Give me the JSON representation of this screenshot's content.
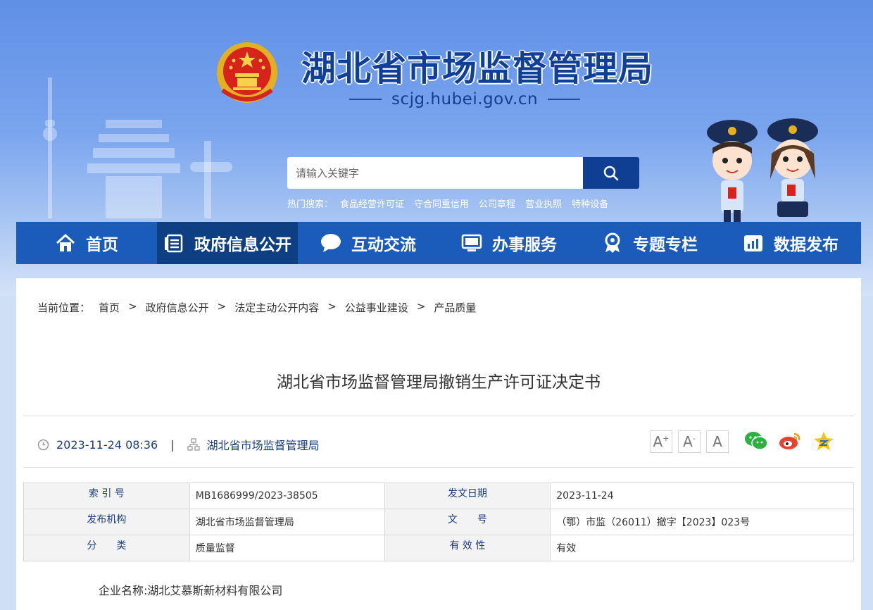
{
  "site": {
    "title": "湖北省市场监督管理局",
    "domain": "scjg.hubei.gov.cn"
  },
  "search": {
    "placeholder": "请输入关键字",
    "hot_label": "热门搜索：",
    "hot_terms": [
      "食品经营许可证",
      "守合同重信用",
      "公司章程",
      "营业执照",
      "特种设备"
    ]
  },
  "nav": {
    "items": [
      {
        "label": "首页",
        "icon": "home-icon"
      },
      {
        "label": "政府信息公开",
        "icon": "document-list-icon"
      },
      {
        "label": "互动交流",
        "icon": "chat-bubble-icon"
      },
      {
        "label": "办事服务",
        "icon": "monitor-icon"
      },
      {
        "label": "专题专栏",
        "icon": "ribbon-badge-icon"
      },
      {
        "label": "数据发布",
        "icon": "bar-chart-icon"
      }
    ],
    "active_index": 1
  },
  "breadcrumb": {
    "label": "当前位置：",
    "items": [
      "首页",
      "政府信息公开",
      "法定主动公开内容",
      "公益事业建设",
      "产品质量"
    ],
    "separator": ">"
  },
  "article": {
    "title": "湖北省市场监督管理局撤销生产许可证决定书",
    "datetime": "2023-11-24 08:36",
    "source": "湖北省市场监督管理局",
    "meta_separator": "|"
  },
  "font_tools": [
    "A+",
    "A-",
    "A"
  ],
  "share_icons": [
    "wechat-icon",
    "weibo-icon",
    "qzone-icon"
  ],
  "info_table": {
    "rows": [
      [
        "索 引 号",
        "MB1686999/2023-38505",
        "发文日期",
        "2023-11-24"
      ],
      [
        "发布机构",
        "湖北省市场监督管理局",
        "文　　号",
        "（鄂）市监（26011）撤字【2023】023号"
      ],
      [
        "分　　类",
        "质量监督",
        "有 效 性",
        "有效"
      ]
    ]
  },
  "content": {
    "company_line": "企业名称:湖北艾慕斯新材料有限公司"
  },
  "colors": {
    "nav_bg": "#1b5bb9",
    "nav_active": "#0e3f82",
    "title_blue": "#0f3f96",
    "search_btn": "#0f3f93"
  }
}
